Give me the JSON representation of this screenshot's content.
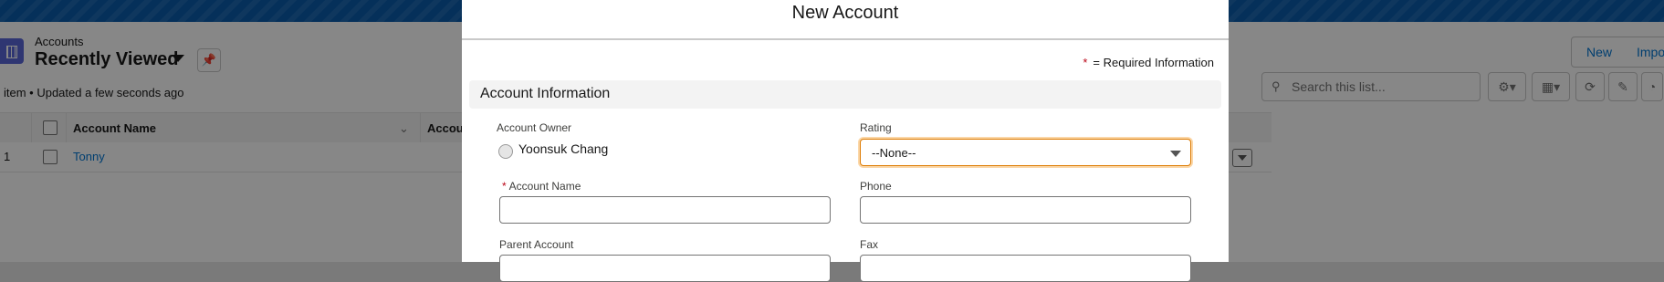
{
  "list": {
    "object_label": "Accounts",
    "view_title": "Recently Viewed",
    "meta": "item • Updated a few seconds ago",
    "new_label": "New",
    "import_label": "Impo",
    "search_placeholder": "Search this list...",
    "columns": [
      "Account Name",
      "Accou"
    ],
    "rows": [
      {
        "num": "1",
        "name": "Tonny"
      }
    ]
  },
  "modal": {
    "title": "New Account",
    "required_note": "= Required Information",
    "required_star": "*",
    "section_title": "Account Information",
    "fields": {
      "owner_label": "Account Owner",
      "owner_value": "Yoonsuk Chang",
      "rating_label": "Rating",
      "rating_value": "--None--",
      "account_name_label": "Account Name",
      "phone_label": "Phone",
      "parent_account_label": "Parent Account",
      "fax_label": "Fax"
    }
  },
  "colors": {
    "brand": "#0176d3",
    "focus": "#dd7a01",
    "required": "#ba0517"
  }
}
